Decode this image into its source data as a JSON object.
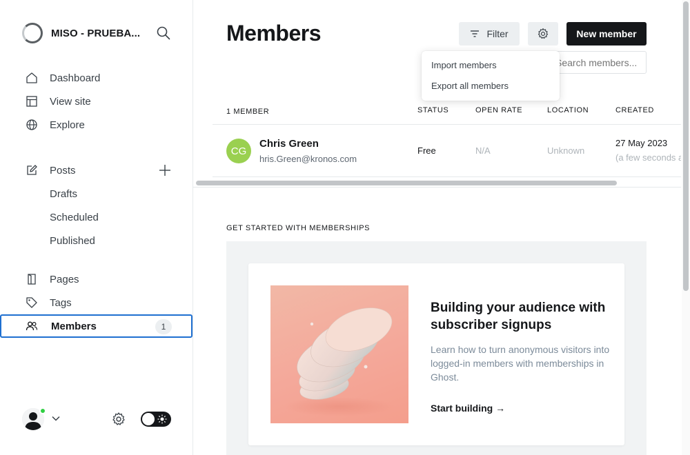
{
  "brand": {
    "name": "MISO - PRUEBA..."
  },
  "sidebar": {
    "nav_main": [
      {
        "label": "Dashboard",
        "icon": "home-icon"
      },
      {
        "label": "View site",
        "icon": "layout-icon"
      },
      {
        "label": "Explore",
        "icon": "globe-icon"
      }
    ],
    "posts": {
      "label": "Posts",
      "icon": "edit-icon",
      "sub": [
        "Drafts",
        "Scheduled",
        "Published"
      ]
    },
    "nav_content": [
      {
        "label": "Pages",
        "icon": "page-icon"
      },
      {
        "label": "Tags",
        "icon": "tag-icon"
      },
      {
        "label": "Members",
        "icon": "members-icon",
        "count": "1",
        "active": true
      }
    ]
  },
  "header": {
    "title": "Members",
    "filter_label": "Filter",
    "new_member_label": "New member",
    "search_placeholder": "Search members..."
  },
  "dropdown": {
    "items": [
      "Import members",
      "Export all members"
    ]
  },
  "table": {
    "columns": [
      "1 MEMBER",
      "STATUS",
      "OPEN RATE",
      "LOCATION",
      "CREATED"
    ],
    "rows": [
      {
        "initials": "CG",
        "name": "Chris Green",
        "email": "hris.Green@kronos.com",
        "status": "Free",
        "open_rate": "N/A",
        "location": "Unknown",
        "created": "27 May 2023",
        "created_relative": "(a few seconds ago)"
      }
    ]
  },
  "promo": {
    "section_label": "GET STARTED WITH MEMBERSHIPS",
    "title": "Building your audience with subscriber signups",
    "text": "Learn how to turn anonymous visitors into logged-in members with memberships in Ghost.",
    "link": "Start building →"
  },
  "colors": {
    "accent": "#1e6fd0",
    "online": "#30cf43",
    "avatar_bg": "#9ad050",
    "primary_button": "#15171a"
  }
}
